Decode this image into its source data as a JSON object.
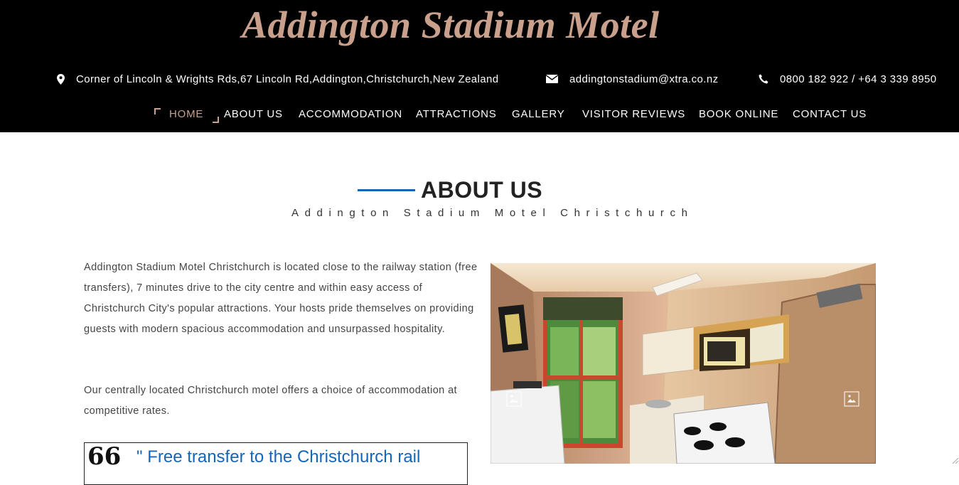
{
  "brand": {
    "logo_text": "Addington Stadium Motel",
    "logo_color": "#c9a08c"
  },
  "contact": {
    "address": "Corner of Lincoln & Wrights Rds,67 Lincoln Rd,Addington,Christchurch,New Zealand",
    "email": "addingtonstadium@xtra.co.nz",
    "phone": "0800 182 922 / +64 3 339 8950",
    "icons": [
      "map-marker-icon",
      "envelope-icon",
      "phone-icon"
    ]
  },
  "nav": {
    "items": [
      {
        "label": "HOME",
        "active": true
      },
      {
        "label": "ABOUT US"
      },
      {
        "label": "ACCOMMODATION"
      },
      {
        "label": "ATTRACTIONS"
      },
      {
        "label": "GALLERY"
      },
      {
        "label": "VISITOR REVIEWS"
      },
      {
        "label": "BOOK ONLINE"
      },
      {
        "label": "CONTACT US"
      }
    ]
  },
  "about": {
    "title": "ABOUT US",
    "subtitle": "Addington Stadium Motel Christchurch",
    "paragraphs": [
      "Addington Stadium Motel Christchurch is located close to the railway station (free transfers), 7 minutes drive to the city centre and within easy access of Christchurch City's popular attractions. Your hosts pride themselves on providing guests with modern spacious accommodation and unsurpassed hospitality.",
      "Our centrally located Christchurch motel offers a choice of accommodation at competitive rates."
    ],
    "quote_mark": "66",
    "quote": "\" Free transfer to the Christchurch rail"
  },
  "gallery": {
    "image_alt": "motel kitchenette",
    "prev_icon": "image-icon",
    "next_icon": "image-icon"
  },
  "colors": {
    "header_bg": "#000000",
    "accent_blue": "#1565b8",
    "accent_gold": "#c9a08c"
  }
}
